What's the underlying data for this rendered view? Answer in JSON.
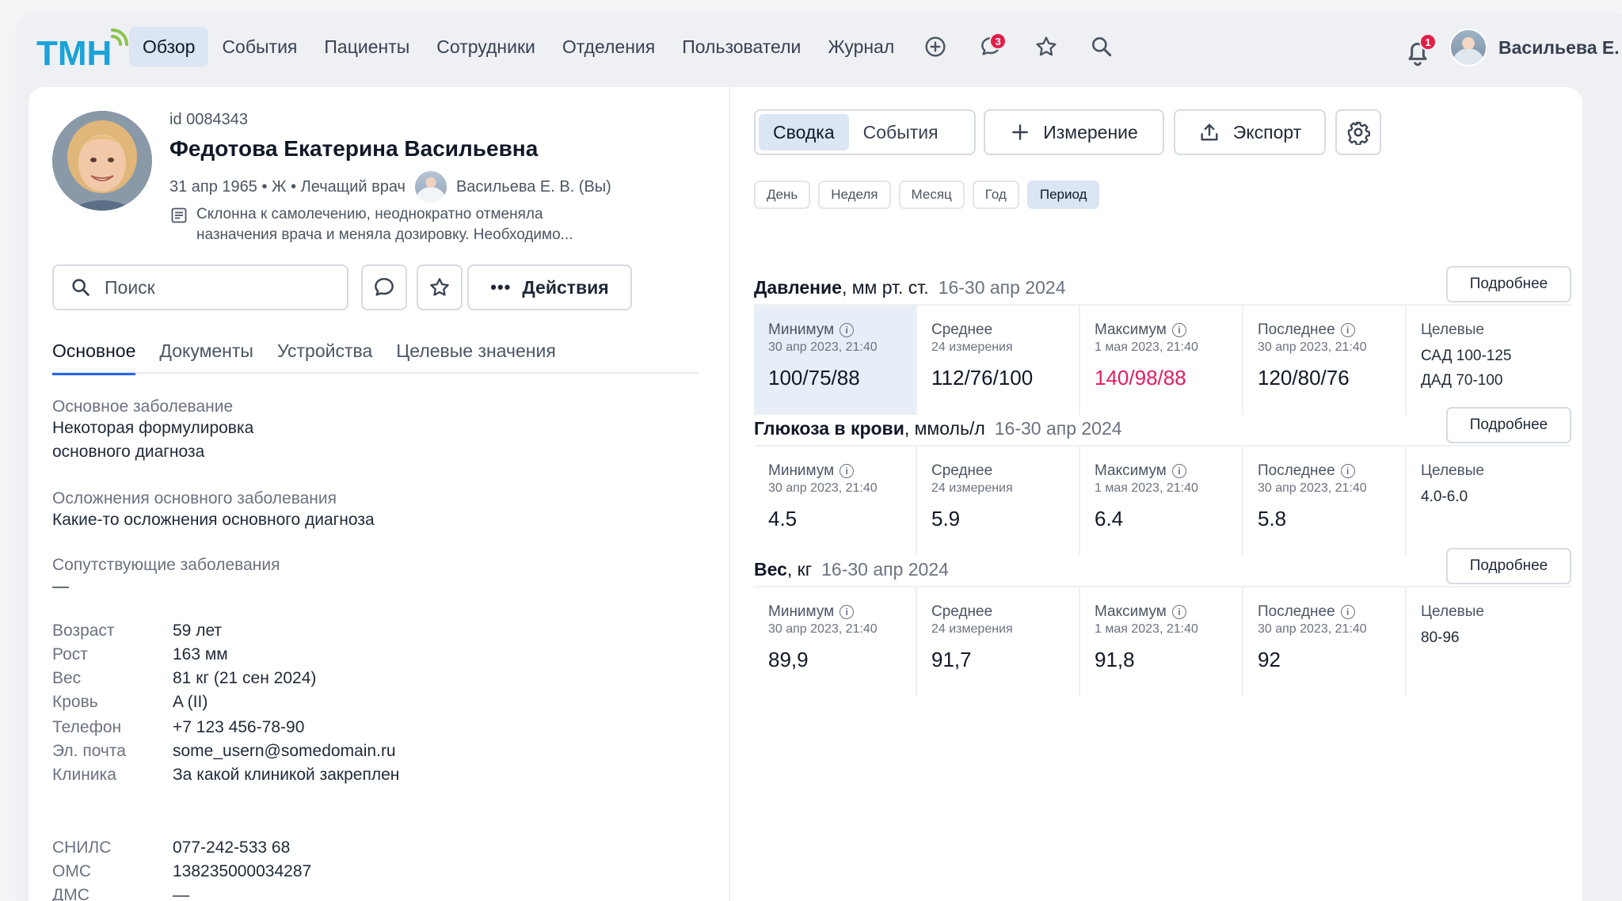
{
  "header": {
    "logo_text": "ТМН",
    "nav": [
      {
        "label": "Обзор",
        "active": true
      },
      {
        "label": "События"
      },
      {
        "label": "Пациенты"
      },
      {
        "label": "Сотрудники"
      },
      {
        "label": "Отделения"
      },
      {
        "label": "Пользователи"
      },
      {
        "label": "Журнал"
      }
    ],
    "chat_badge": "3",
    "bell_badge": "1",
    "user_name": "Васильева Е. В."
  },
  "patient": {
    "id": "id 0084343",
    "name": "Федотова Екатерина Васильевна",
    "meta": "31 апр 1965 • Ж • Лечащий врач",
    "doctor": "Васильева Е. В. (Вы)",
    "note": "Склонна к самолечению, неоднократно отменяла назначения врача и меняла дозировку. Необходимо..."
  },
  "actions": {
    "search_placeholder": "Поиск",
    "actions_label": "Действия"
  },
  "tabs": [
    "Основное",
    "Документы",
    "Устройства",
    "Целевые значения"
  ],
  "details": {
    "main_disease_label": "Основное заболевание",
    "main_disease_value": "Некоторая формулировка основного диагноза",
    "complications_label": "Осложнения основного заболевания",
    "complications_value": "Какие-то осложнения основного диагноза",
    "comorbid_label": "Сопутствующие заболевания",
    "comorbid_value": "—",
    "group1": [
      {
        "k": "Возраст",
        "v": "59 лет"
      },
      {
        "k": "Рост",
        "v": "163 мм"
      },
      {
        "k": "Вес",
        "v": "81 кг (21 сен 2024)"
      },
      {
        "k": "Кровь",
        "v": "A (II)"
      }
    ],
    "group2": [
      {
        "k": "Телефон",
        "v": "+7 123 456-78-90"
      },
      {
        "k": "Эл. почта",
        "v": "some_usern@somedomain.ru"
      },
      {
        "k": "Клиника",
        "v": "За какой клиникой закреплен"
      }
    ],
    "group3": [
      {
        "k": "СНИЛС",
        "v": "077-242-533 68"
      },
      {
        "k": "ОМС",
        "v": "138235000034287"
      },
      {
        "k": "ДМС",
        "v": "—"
      }
    ]
  },
  "right": {
    "seg": [
      {
        "label": "Сводка",
        "active": true
      },
      {
        "label": "События"
      }
    ],
    "measure_label": "Измерение",
    "export_label": "Экспорт",
    "periods": [
      {
        "label": "День"
      },
      {
        "label": "Неделя"
      },
      {
        "label": "Месяц"
      },
      {
        "label": "Год"
      },
      {
        "label": "Период",
        "active": true
      }
    ],
    "more_label": "Подробнее",
    "sections": [
      {
        "title": "Давление",
        "unit": ", мм рт. ст.",
        "period": "16-30 апр 2024",
        "stats": [
          {
            "label": "Минимум",
            "sub": "30 апр 2023, 21:40",
            "value": "100/75/88",
            "info": true,
            "highlight": true
          },
          {
            "label": "Среднее",
            "sub": "24 измерения",
            "value": "112/76/100"
          },
          {
            "label": "Максимум",
            "sub": "1 мая 2023, 21:40",
            "value": "140/98/88",
            "info": true,
            "red": true
          },
          {
            "label": "Последнее",
            "sub": "30 апр 2023, 21:40",
            "value": "120/80/76",
            "info": true
          }
        ],
        "target_label": "Целевые",
        "targets": [
          {
            "k": "САД",
            "v": "100-125"
          },
          {
            "k": "ДАД",
            "v": "70-100"
          }
        ]
      },
      {
        "title": "Глюкоза в крови",
        "unit": ", ммоль/л",
        "period": "16-30 апр 2024",
        "stats": [
          {
            "label": "Минимум",
            "sub": "30 апр 2023, 21:40",
            "value": "4.5",
            "info": true
          },
          {
            "label": "Среднее",
            "sub": "24 измерения",
            "value": "5.9"
          },
          {
            "label": "Максимум",
            "sub": "1 мая 2023, 21:40",
            "value": "6.4",
            "info": true
          },
          {
            "label": "Последнее",
            "sub": "30 апр 2023, 21:40",
            "value": "5.8",
            "info": true
          }
        ],
        "target_label": "Целевые",
        "targets": [
          {
            "k": "",
            "v": "4.0-6.0"
          }
        ]
      },
      {
        "title": "Вес",
        "unit": ", кг",
        "period": "16-30 апр 2024",
        "stats": [
          {
            "label": "Минимум",
            "sub": "30 апр 2023, 21:40",
            "value": "89,9",
            "info": true
          },
          {
            "label": "Среднее",
            "sub": "24 измерения",
            "value": "91,7"
          },
          {
            "label": "Максимум",
            "sub": "1 мая 2023, 21:40",
            "value": "91,8",
            "info": true
          },
          {
            "label": "Последнее",
            "sub": "30 апр 2023, 21:40",
            "value": "92",
            "info": true
          }
        ],
        "target_label": "Целевые",
        "targets": [
          {
            "k": "",
            "v": "80-96"
          }
        ]
      }
    ]
  }
}
